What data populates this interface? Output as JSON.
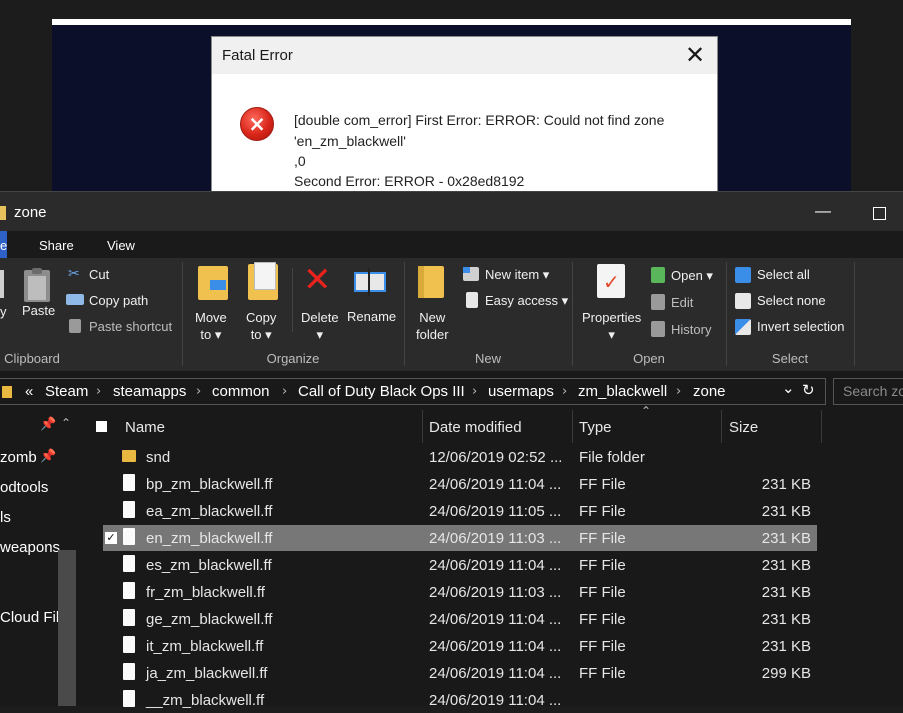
{
  "background": {
    "caption": "(_________________)"
  },
  "dialog": {
    "title": "Fatal Error",
    "close_glyph": "✕",
    "icon": "error-icon",
    "lines": [
      "[double com_error] First Error: ERROR: Could not find zone",
      "'en_zm_blackwell'",
      " ,0",
      "Second Error: ERROR - 0x28ed8192"
    ]
  },
  "explorer": {
    "title": "zone",
    "minimize_glyph": "—",
    "tabs": {
      "home": "e",
      "share": "Share",
      "view": "View"
    },
    "ribbon": {
      "clipboard": {
        "group": "Clipboard",
        "pin_partial": "y",
        "paste": "Paste",
        "cut": "Cut",
        "copy_path": "Copy path",
        "paste_shortcut": "Paste shortcut"
      },
      "organize": {
        "group": "Organize",
        "move_to": "Move\nto ▾",
        "copy_to": "Copy\nto ▾",
        "delete": "Delete\n▾",
        "rename": "Rename"
      },
      "new": {
        "group": "New",
        "new_folder": "New\nfolder",
        "new_item": "New item ▾",
        "easy_access": "Easy access ▾"
      },
      "open": {
        "group": "Open",
        "properties": "Properties\n▾",
        "open": "Open ▾",
        "edit": "Edit",
        "history": "History"
      },
      "select": {
        "group": "Select",
        "select_all": "Select all",
        "select_none": "Select none",
        "invert": "Invert selection"
      }
    },
    "address": {
      "prefix": "«",
      "crumbs": [
        "Steam",
        "steamapps",
        "common",
        "Call of Duty Black Ops III",
        "usermaps",
        "zm_blackwell",
        "zone"
      ],
      "separator": "›",
      "dropdown_glyph": "⌄",
      "refresh_glyph": "↻",
      "search_placeholder": "Search zo"
    },
    "nav": {
      "items": [
        "zomb",
        "odtools",
        "ls",
        "weapons",
        "Cloud File"
      ]
    },
    "columns": {
      "name": "Name",
      "date": "Date modified",
      "type": "Type",
      "size": "Size"
    },
    "files": [
      {
        "name": "snd",
        "date": "12/06/2019 02:52 ...",
        "type": "File folder",
        "size": "",
        "folder": true
      },
      {
        "name": "bp_zm_blackwell.ff",
        "date": "24/06/2019 11:04 ...",
        "type": "FF File",
        "size": "231 KB"
      },
      {
        "name": "ea_zm_blackwell.ff",
        "date": "24/06/2019 11:05 ...",
        "type": "FF File",
        "size": "231 KB"
      },
      {
        "name": "en_zm_blackwell.ff",
        "date": "24/06/2019 11:03 ...",
        "type": "FF File",
        "size": "231 KB",
        "selected": true
      },
      {
        "name": "es_zm_blackwell.ff",
        "date": "24/06/2019 11:04 ...",
        "type": "FF File",
        "size": "231 KB"
      },
      {
        "name": "fr_zm_blackwell.ff",
        "date": "24/06/2019 11:03 ...",
        "type": "FF File",
        "size": "231 KB"
      },
      {
        "name": "ge_zm_blackwell.ff",
        "date": "24/06/2019 11:04 ...",
        "type": "FF File",
        "size": "231 KB"
      },
      {
        "name": "it_zm_blackwell.ff",
        "date": "24/06/2019 11:04 ...",
        "type": "FF File",
        "size": "231 KB"
      },
      {
        "name": "ja_zm_blackwell.ff",
        "date": "24/06/2019 11:04 ...",
        "type": "FF File",
        "size": "299 KB"
      },
      {
        "name": "__zm_blackwell.ff",
        "date": "24/06/2019 11:04 ...",
        "type": "",
        "size": ""
      }
    ],
    "checked_glyph": "✓"
  }
}
